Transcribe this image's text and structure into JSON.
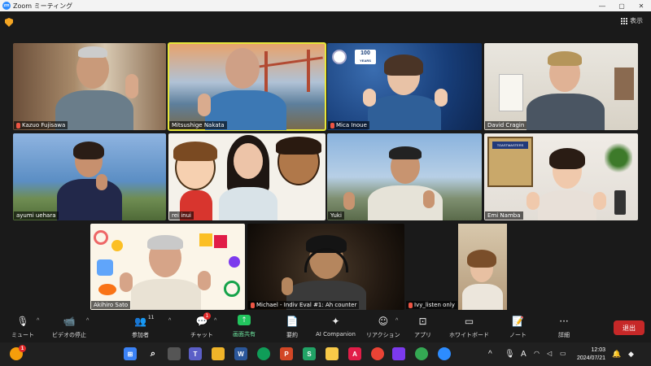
{
  "window": {
    "title": "Zoom ミーティング",
    "app_icon": "zm",
    "controls": [
      "—",
      "▢",
      "✕"
    ]
  },
  "top": {
    "view_label": "表示"
  },
  "participants": [
    {
      "name": "Kazuo Fujisawa",
      "muted": true
    },
    {
      "name": "Mitsushige Nakata",
      "muted": false,
      "active": true
    },
    {
      "name": "Mica Inoue",
      "muted": true
    },
    {
      "name": "David Cragin",
      "muted": false
    },
    {
      "name": "ayumi uehara",
      "muted": false
    },
    {
      "name": "rei inui",
      "muted": false
    },
    {
      "name": "Yuki",
      "muted": false
    },
    {
      "name": "Emi Namba",
      "muted": false
    },
    {
      "name": "Akihiro Sato",
      "muted": false
    },
    {
      "name": "Michael - Indiv Eval #1: Ah counter",
      "muted": true
    },
    {
      "name": "Ivy_listen only",
      "muted": true
    }
  ],
  "backgrounds": {
    "mica_badge": "100",
    "mica_badge_sub": "YEARS",
    "emi_banner": "TOASTMASTERS"
  },
  "toolbar": {
    "mute": "ミュート",
    "video": "ビデオの停止",
    "participants": "参加者",
    "participants_count": "11",
    "chat": "チャット",
    "chat_badge": "1",
    "share": "画面共有",
    "summary": "要約",
    "ai": "AI Companion",
    "reactions": "リアクション",
    "apps": "アプリ",
    "whiteboard": "ホワイトボード",
    "notes": "ノート",
    "more": "詳細",
    "leave": "退出"
  },
  "taskbar": {
    "time": "12:03",
    "date": "2024/07/21",
    "ime": "A",
    "notify_badge": "1"
  },
  "colors": {
    "share_green": "#22c55e",
    "leave_red": "#c62828",
    "active_speaker": "#e6e63a",
    "zoom_blue": "#2d8cff"
  }
}
